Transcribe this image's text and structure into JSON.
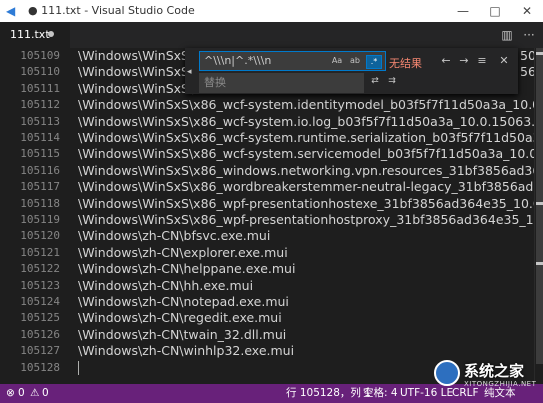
{
  "window": {
    "title": "● 111.txt - Visual Studio Code",
    "minimize_glyph": "—",
    "maximize_glyph": "□",
    "close_glyph": "✕"
  },
  "tab": {
    "name": "111.txt"
  },
  "editor": {
    "lines": [
      {
        "num": "105109",
        "text": "\\Windows\\WinSxS\\"
      },
      {
        "num": "105110",
        "text": "\\Windows\\WinSxS\\"
      },
      {
        "num": "105111",
        "text": "\\Windows\\WinSxS\\"
      },
      {
        "num": "105112",
        "text": "\\Windows\\WinSxS\\x86_wcf-system.identitymodel_b03f5f7f11d50a3a_10.0.15063.0"
      },
      {
        "num": "105113",
        "text": "\\Windows\\WinSxS\\x86_wcf-system.io.log_b03f5f7f11d50a3a_10.0.15063.0_none_9"
      },
      {
        "num": "105114",
        "text": "\\Windows\\WinSxS\\x86_wcf-system.runtime.serialization_b03f5f7f11d50a3a_10.1"
      },
      {
        "num": "105115",
        "text": "\\Windows\\WinSxS\\x86_wcf-system.servicemodel_b03f5f7f11d50a3a_10.0.15063.0"
      },
      {
        "num": "105116",
        "text": "\\Windows\\WinSxS\\x86_windows.networking.vpn.resources_31bf3856ad364e35_10"
      },
      {
        "num": "105117",
        "text": "\\Windows\\WinSxS\\x86_wordbreakerstemmer-neutral-legacy_31bf3856ad364e35_"
      },
      {
        "num": "105118",
        "text": "\\Windows\\WinSxS\\x86_wpf-presentationhostexe_31bf3856ad364e35_10.0.15063.0"
      },
      {
        "num": "105119",
        "text": "\\Windows\\WinSxS\\x86_wpf-presentationhostproxy_31bf3856ad364e35_10.0.1506"
      },
      {
        "num": "105120",
        "text": "\\Windows\\zh-CN\\bfsvc.exe.mui"
      },
      {
        "num": "105121",
        "text": "\\Windows\\zh-CN\\explorer.exe.mui"
      },
      {
        "num": "105122",
        "text": "\\Windows\\zh-CN\\helppane.exe.mui"
      },
      {
        "num": "105123",
        "text": "\\Windows\\zh-CN\\hh.exe.mui"
      },
      {
        "num": "105124",
        "text": "\\Windows\\zh-CN\\notepad.exe.mui"
      },
      {
        "num": "105125",
        "text": "\\Windows\\zh-CN\\regedit.exe.mui"
      },
      {
        "num": "105126",
        "text": "\\Windows\\zh-CN\\twain_32.dll.mui"
      },
      {
        "num": "105127",
        "text": "\\Windows\\zh-CN\\winhlp32.exe.mui"
      },
      {
        "num": "105128",
        "text": ""
      }
    ],
    "right_fragments": [
      "50",
      "56"
    ]
  },
  "find_widget": {
    "find_value": "^\\\\\\n|^.*\\\\\\n",
    "match_case_label": "Aa",
    "whole_word_label": "ab",
    "regex_label": ".*",
    "no_results": "无结果",
    "replace_placeholder": "替换"
  },
  "status": {
    "errors": "0",
    "warnings": "0",
    "position": "行 105128，列 1",
    "indent": "空格: 4",
    "encoding": "UTF-16 LE",
    "eol": "CRLF",
    "language": "纯文本"
  },
  "watermark": {
    "cn": "系统之家",
    "en": "XITONGZHIJIA.NET"
  },
  "colors": {
    "status_bar": "#68217a",
    "accent": "#007acc",
    "no_results": "#f48771"
  }
}
